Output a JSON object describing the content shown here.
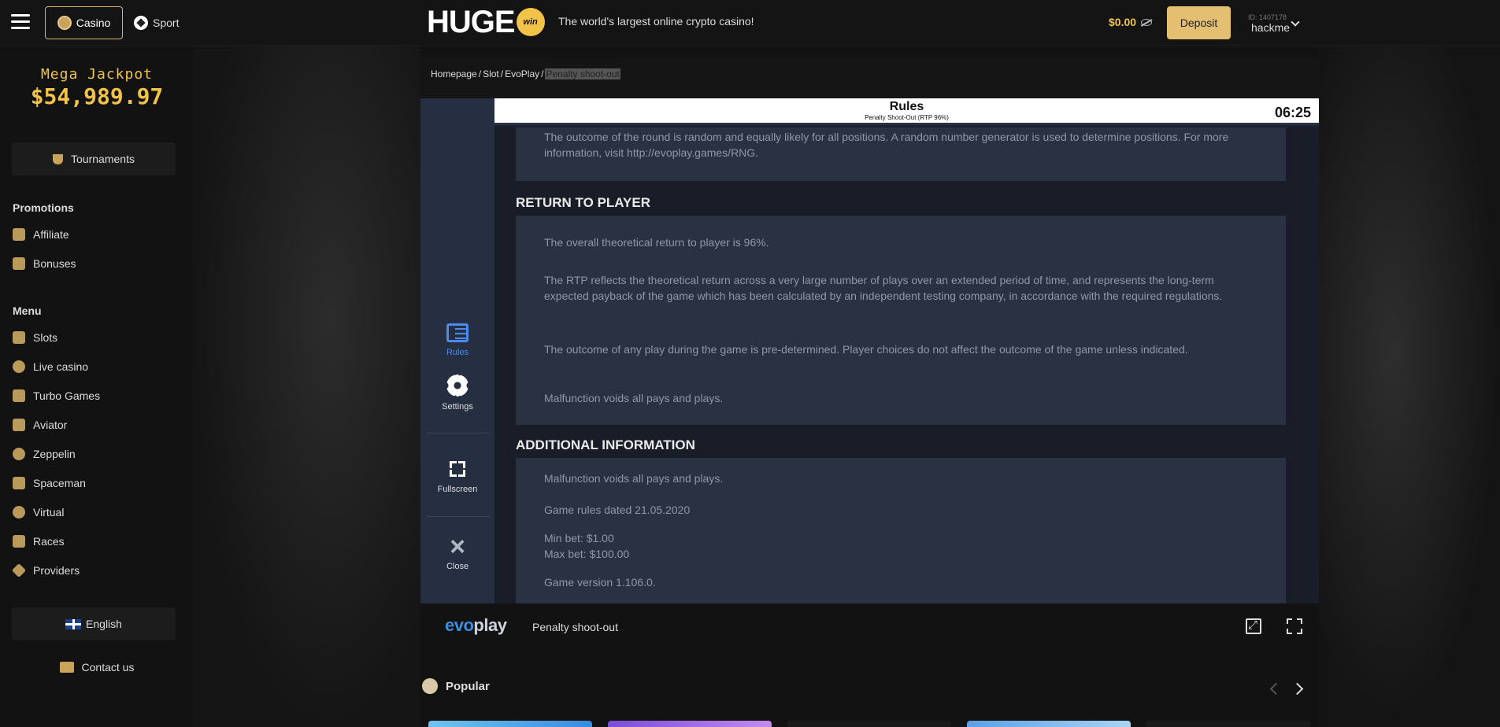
{
  "header": {
    "tab_casino": "Casino",
    "tab_sport": "Sport",
    "logo_text": "HUGE",
    "logo_badge": "win",
    "tagline": "The world's largest online crypto casino!",
    "balance": "$0.00",
    "deposit_label": "Deposit",
    "user_id": "ID: 1407178",
    "username": "hackme"
  },
  "sidebar": {
    "jackpot_title": "Mega Jackpot",
    "jackpot_amount": "$54,989.97",
    "tournaments_label": "Tournaments",
    "promotions_title": "Promotions",
    "promotions": [
      {
        "label": "Affiliate",
        "icon": "people-icon"
      },
      {
        "label": "Bonuses",
        "icon": "gift-icon"
      }
    ],
    "menu_title": "Menu",
    "menu": [
      {
        "label": "Slots",
        "icon": "slot-icon"
      },
      {
        "label": "Live casino",
        "icon": "chip-icon"
      },
      {
        "label": "Turbo Games",
        "icon": "rocket-icon"
      },
      {
        "label": "Aviator",
        "icon": "plane-icon"
      },
      {
        "label": "Zeppelin",
        "icon": "zeppelin-icon"
      },
      {
        "label": "Spaceman",
        "icon": "spaceman-icon"
      },
      {
        "label": "Virtual",
        "icon": "ball-icon"
      },
      {
        "label": "Races",
        "icon": "horse-icon"
      },
      {
        "label": "Providers",
        "icon": "diamond-icon"
      }
    ],
    "language_label": "English",
    "contact_label": "Contact us"
  },
  "breadcrumb": [
    "Homepage",
    "Slot",
    "EvoPlay",
    "Penalty shoot-out"
  ],
  "game": {
    "side_buttons": {
      "rules": "Rules",
      "settings": "Settings",
      "fullscreen": "Fullscreen",
      "close": "Close"
    },
    "rules_title": "Rules",
    "rules_subtitle": "Penalty Shoot-Out (RTP 96%)",
    "timer": "06:25",
    "intro_text": "The outcome of the round is random and equally likely for all positions. A random number generator is used to determine positions. For more information, visit http://evoplay.games/RNG.",
    "rtp_heading": "RETURN TO PLAYER",
    "rtp_paragraphs": [
      "The overall theoretical return to player is 96%.",
      "The RTP reflects the theoretical return across a very large number of plays over an extended period of time, and represents the long-term expected payback of the game which has been calculated by an independent testing company, in accordance with the required regulations.",
      "The outcome of any play during the game is pre-determined. Player choices do not affect the outcome of the game unless indicated.",
      "Malfunction voids all pays and plays."
    ],
    "additional_heading": "ADDITIONAL INFORMATION",
    "additional_paragraphs": [
      "Malfunction voids all pays and plays.",
      "Game rules dated 21.05.2020",
      "Min bet: $1.00",
      "Max bet: $100.00",
      "Game version 1.106.0."
    ]
  },
  "footer": {
    "provider_logo_a": "evo",
    "provider_logo_b": "play",
    "game_name": "Penalty shoot-out"
  },
  "popular": {
    "label": "Popular"
  },
  "colors": {
    "accent": "#e4bf72",
    "jackpot": "#f1c348",
    "game_bg": "#1d2231",
    "active_blue": "#4b8bf0"
  }
}
